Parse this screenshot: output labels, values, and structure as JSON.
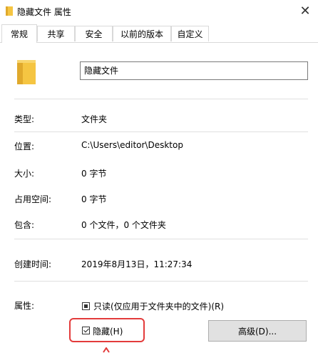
{
  "window": {
    "title": "隐藏文件 属性",
    "close_glyph": "✕"
  },
  "tabs": [
    {
      "label": "常规",
      "active": true
    },
    {
      "label": "共享",
      "active": false
    },
    {
      "label": "安全",
      "active": false
    },
    {
      "label": "以前的版本",
      "active": false
    },
    {
      "label": "自定义",
      "active": false
    }
  ],
  "general": {
    "name_value": "隐藏文件",
    "type_label": "类型:",
    "type_value": "文件夹",
    "location_label": "位置:",
    "location_value": "C:\\Users\\editor\\Desktop",
    "size_label": "大小:",
    "size_value": "0 字节",
    "size_on_disk_label": "占用空间:",
    "size_on_disk_value": "0 字节",
    "contains_label": "包含:",
    "contains_value": "0 个文件，0 个文件夹",
    "created_label": "创建时间:",
    "created_value": "2019年8月13日，11:27:34",
    "attributes_label": "属性:",
    "readonly_label": "只读(仅应用于文件夹中的文件)(R)",
    "readonly_state": "indeterminate",
    "hidden_label": "隐藏(H)",
    "hidden_checked": true,
    "advanced_button": "高级(D)..."
  },
  "colors": {
    "folder_yellow": "#f5c542",
    "highlight_red": "#e33b3b",
    "button_gray": "#e1e1e1"
  },
  "icons": {
    "title_icon": "folder-icon",
    "large_icon": "folder-icon"
  }
}
